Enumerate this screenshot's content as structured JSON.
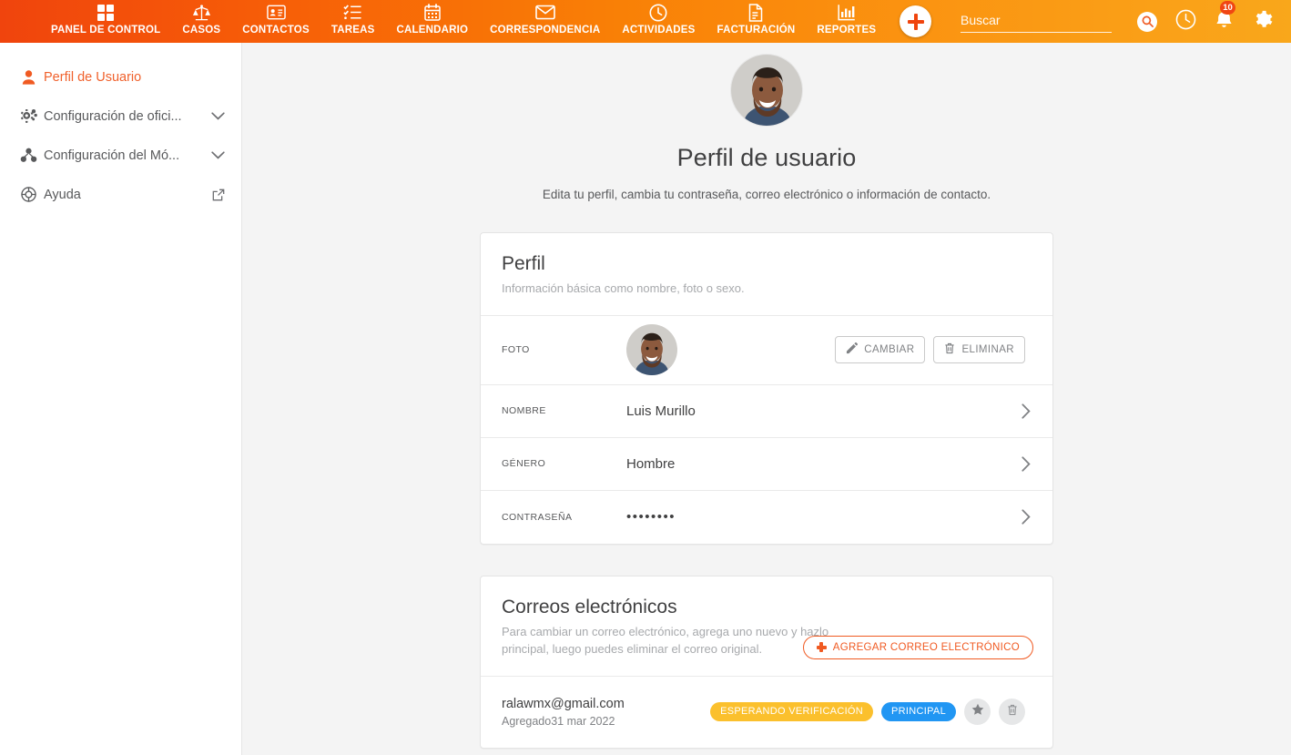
{
  "topbar": {
    "nav": [
      {
        "label": "PANEL DE CONTROL",
        "icon": "dashboard-grid-icon"
      },
      {
        "label": "CASOS",
        "icon": "scales-of-justice-icon"
      },
      {
        "label": "CONTACTOS",
        "icon": "id-card-icon"
      },
      {
        "label": "TAREAS",
        "icon": "checklist-icon"
      },
      {
        "label": "CALENDARIO",
        "icon": "calendar-icon"
      },
      {
        "label": "CORRESPONDENCIA",
        "icon": "envelope-icon"
      },
      {
        "label": "ACTIVIDADES",
        "icon": "clock-icon"
      },
      {
        "label": "FACTURACIÓN",
        "icon": "invoice-document-icon"
      },
      {
        "label": "REPORTES",
        "icon": "bar-chart-icon"
      }
    ],
    "add_button_label": "+",
    "search": {
      "value": "",
      "placeholder": "Buscar"
    },
    "notifications_count": "10",
    "colors": {
      "gradient_start": "#f0440d",
      "gradient_mid": "#f98006",
      "gradient_end": "#f9a71b",
      "accent": "#f05a22"
    }
  },
  "sidebar": {
    "items": [
      {
        "label": "Perfil de Usuario",
        "icon": "user-icon",
        "active": true,
        "trailing": "none"
      },
      {
        "label": "Configuración de ofici...",
        "icon": "cogs-icon",
        "active": false,
        "trailing": "chevron-down"
      },
      {
        "label": "Configuración del Mó...",
        "icon": "modules-icon",
        "active": false,
        "trailing": "chevron-down"
      },
      {
        "label": "Ayuda",
        "icon": "lifebuoy-icon",
        "active": false,
        "trailing": "external-link"
      }
    ]
  },
  "main": {
    "page_title": "Perfil de usuario",
    "page_subtitle": "Edita tu perfil, cambia tu contraseña, correo electrónico o información de contacto.",
    "profile_card": {
      "title": "Perfil",
      "description": "Información básica como nombre, foto o sexo.",
      "photo_row": {
        "label": "FOTO",
        "change_label": "CAMBIAR",
        "delete_label": "ELIMINAR"
      },
      "rows": [
        {
          "label": "NOMBRE",
          "value": "Luis Murillo",
          "masked": false
        },
        {
          "label": "GÉNERO",
          "value": "Hombre",
          "masked": false
        },
        {
          "label": "CONTRASEÑA",
          "value": "••••••••",
          "masked": true
        }
      ]
    },
    "emails_card": {
      "title": "Correos electrónicos",
      "description": "Para cambiar un correo electrónico, agrega uno nuevo y hazlo principal, luego puedes eliminar el correo original.",
      "add_button_label": "AGREGAR CORREO ELECTRÓNICO",
      "entries": [
        {
          "address": "ralawmx@gmail.com",
          "added": "Agregado31 mar 2022",
          "status_badge": "ESPERANDO VERIFICACIÓN",
          "primary_badge": "PRINCIPAL",
          "status_color": "#fbc02d",
          "primary_color": "#2196f3"
        }
      ]
    }
  }
}
